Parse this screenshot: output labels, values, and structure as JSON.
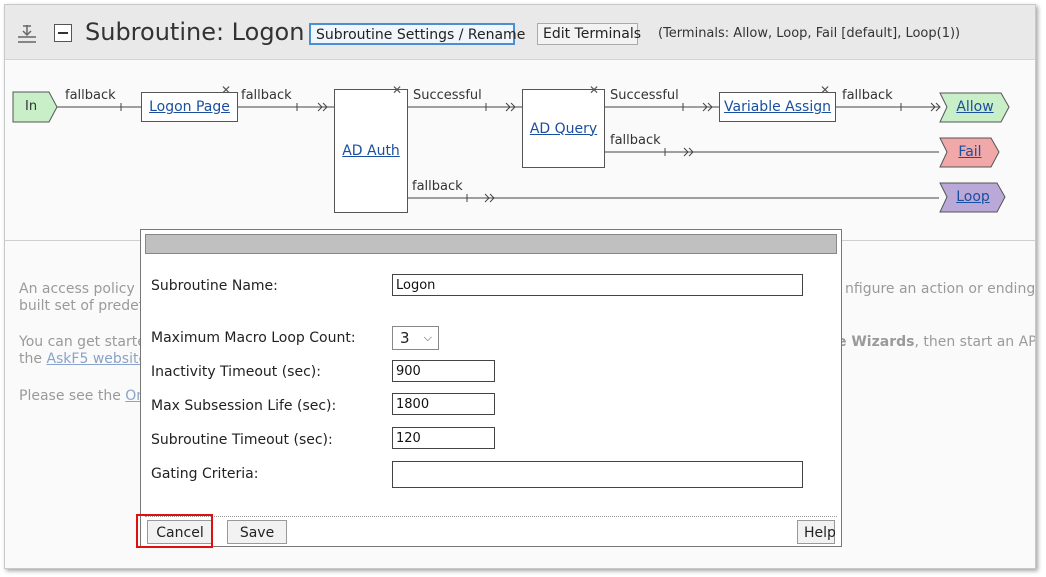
{
  "header": {
    "title": "Subroutine: Logon",
    "settings_button": "Subroutine Settings / Rename",
    "edit_terminals_button": "Edit Terminals",
    "terminals_info": "(Terminals: Allow, Loop, Fail [default], Loop(1))"
  },
  "flow": {
    "start_label": "In",
    "nodes": {
      "logon_page": "Logon Page",
      "ad_auth": "AD Auth",
      "ad_query": "AD Query",
      "variable_assign": "Variable Assign"
    },
    "branches": {
      "in_fallback": "fallback",
      "logon_fallback": "fallback",
      "auth_successful": "Successful",
      "auth_fallback": "fallback",
      "query_successful": "Successful",
      "query_fallback": "fallback",
      "assign_fallback": "fallback"
    },
    "terminals": {
      "allow": "Allow",
      "fail": "Fail",
      "loop": "Loop"
    },
    "colors": {
      "start": "#c8efc8",
      "allow": "#c8efc8",
      "fail": "#f0a8a8",
      "loop": "#b9a8d8"
    }
  },
  "background_text": {
    "line1": "An access policy co",
    "line1_right": "nfigure an action or ending, c",
    "line2": "built set of predefi",
    "line3": "You can get starte",
    "line3_right_bold": "e Wizards",
    "line3_right_rest": ", then start an AP",
    "line4_prefix": "the ",
    "line4_link": "AskF5 website",
    "line5": "Please see the ",
    "line5_link": "On"
  },
  "dialog": {
    "fields": {
      "name_label": "Subroutine Name:",
      "name_value": "Logon",
      "loop_label": "Maximum Macro Loop Count:",
      "loop_value": "3",
      "inactivity_label": "Inactivity Timeout (sec):",
      "inactivity_value": "900",
      "max_life_label": "Max Subsession Life (sec):",
      "max_life_value": "1800",
      "timeout_label": "Subroutine Timeout (sec):",
      "timeout_value": "120",
      "gating_label": "Gating Criteria:",
      "gating_value": ""
    },
    "buttons": {
      "cancel": "Cancel",
      "save": "Save",
      "help": "Help"
    }
  }
}
